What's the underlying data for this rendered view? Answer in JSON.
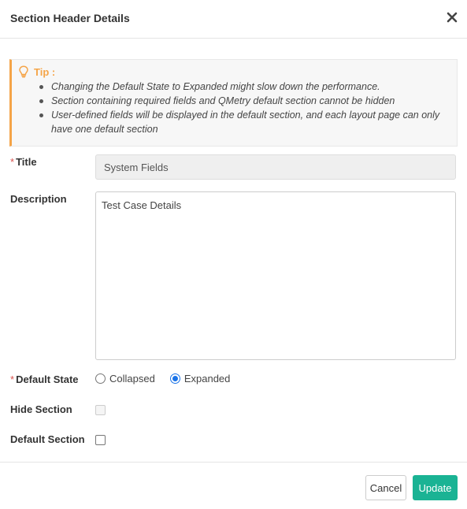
{
  "dialog": {
    "title": "Section Header Details"
  },
  "tip": {
    "label": "Tip :",
    "items": [
      "Changing the Default State to Expanded might slow down the performance.",
      "Section containing required fields and QMetry default section cannot be hidden",
      "User-defined fields will be displayed in the default section, and each layout page can only have one default section"
    ]
  },
  "form": {
    "title_label": "Title",
    "title_value": "System Fields",
    "description_label": "Description",
    "description_value": "Test Case Details",
    "default_state_label": "Default State",
    "state_collapsed": "Collapsed",
    "state_expanded": "Expanded",
    "selected_state": "Expanded",
    "hide_section_label": "Hide Section",
    "hide_section_checked": false,
    "hide_section_disabled": true,
    "default_section_label": "Default Section",
    "default_section_checked": false,
    "required_marker": "*"
  },
  "footer": {
    "cancel_label": "Cancel",
    "update_label": "Update"
  },
  "colors": {
    "tip_accent": "#f5a447",
    "required": "#d9534f",
    "primary_button": "#1ab394",
    "radio_selected": "#1a73e8"
  }
}
